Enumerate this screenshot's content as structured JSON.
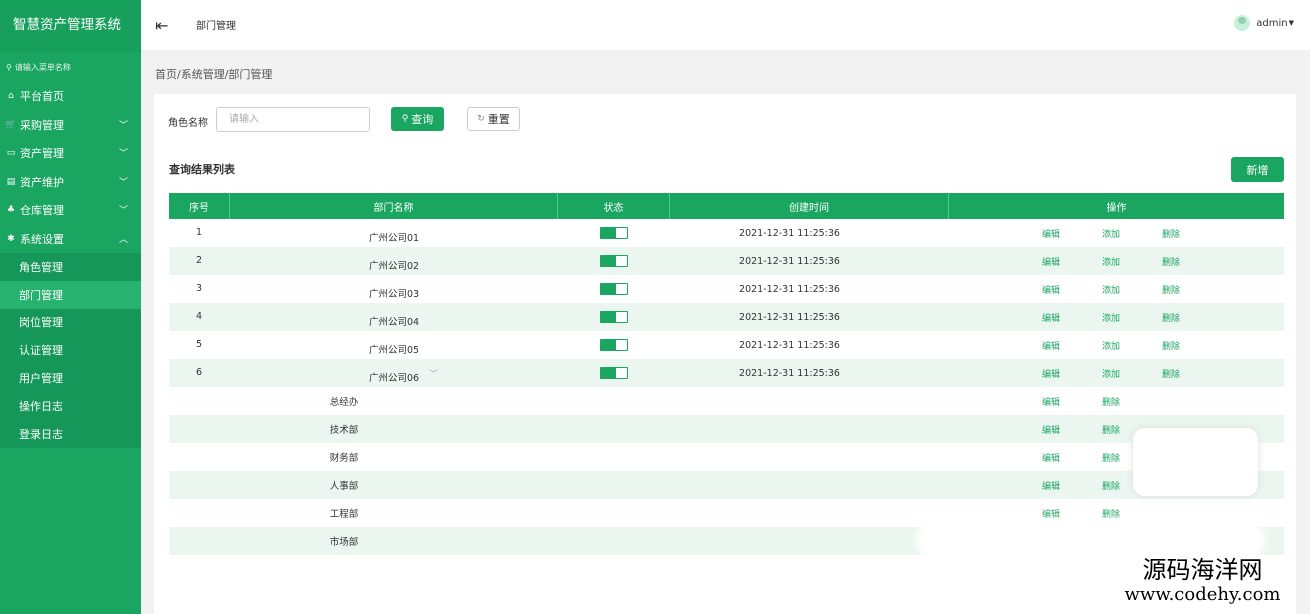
{
  "app": {
    "title": "智慧资产管理系统"
  },
  "sidebar": {
    "search_placeholder": "请输入菜单名称",
    "items": [
      {
        "label": "平台首页",
        "icon": "home-icon",
        "has_chevron": false
      },
      {
        "label": "采购管理",
        "icon": "cart-icon",
        "has_chevron": true
      },
      {
        "label": "资产管理",
        "icon": "monitor-icon",
        "has_chevron": true
      },
      {
        "label": "资产维护",
        "icon": "wrench-icon",
        "has_chevron": true
      },
      {
        "label": "仓库管理",
        "icon": "warehouse-icon",
        "has_chevron": true
      },
      {
        "label": "系统设置",
        "icon": "gear-icon",
        "has_chevron": true,
        "expanded": true
      }
    ],
    "sub_items": [
      "角色管理",
      "部门管理",
      "岗位管理",
      "认证管理",
      "用户管理",
      "操作日志",
      "登录日志"
    ],
    "active_sub": "部门管理"
  },
  "header": {
    "title": "部门管理",
    "user": "admin"
  },
  "breadcrumb": "首页/系统管理/部门管理",
  "search": {
    "label": "角色名称",
    "placeholder": "请输入",
    "query_label": "查询",
    "reset_label": "重置"
  },
  "result": {
    "title": "查询结果列表",
    "add_label": "新增"
  },
  "table": {
    "headers": [
      "序号",
      "部门名称",
      "状态",
      "创建时间",
      "操作"
    ],
    "rows": [
      {
        "no": "1",
        "name": "广州公司01",
        "status": "on",
        "created": "2021-12-31 11:25:36",
        "ops": [
          "编辑",
          "添加",
          "删除"
        ]
      },
      {
        "no": "2",
        "name": "广州公司02",
        "status": "on",
        "created": "2021-12-31 11:25:36",
        "ops": [
          "编辑",
          "添加",
          "删除"
        ]
      },
      {
        "no": "3",
        "name": "广州公司03",
        "status": "on",
        "created": "2021-12-31 11:25:36",
        "ops": [
          "编辑",
          "添加",
          "删除"
        ]
      },
      {
        "no": "4",
        "name": "广州公司04",
        "status": "on",
        "created": "2021-12-31 11:25:36",
        "ops": [
          "编辑",
          "添加",
          "删除"
        ]
      },
      {
        "no": "5",
        "name": "广州公司05",
        "status": "on",
        "created": "2021-12-31 11:25:36",
        "ops": [
          "编辑",
          "添加",
          "删除"
        ]
      },
      {
        "no": "6",
        "name": "广州公司06",
        "status": "on",
        "created": "2021-12-31 11:25:36",
        "ops": [
          "编辑",
          "添加",
          "删除"
        ],
        "expanded": true
      }
    ],
    "child_rows": [
      {
        "name": "总经办",
        "ops": [
          "编辑",
          "删除"
        ]
      },
      {
        "name": "技术部",
        "ops": [
          "编辑",
          "删除"
        ]
      },
      {
        "name": "财务部",
        "ops": [
          "编辑",
          "删除"
        ]
      },
      {
        "name": "人事部",
        "ops": [
          "编辑",
          "删除"
        ]
      },
      {
        "name": "工程部",
        "ops": [
          "编辑",
          "删除"
        ]
      },
      {
        "name": "市场部",
        "ops": []
      }
    ]
  },
  "watermark": {
    "cn": "源码海洋网",
    "url": "www.codehy.com"
  },
  "colors": {
    "primary": "#1aa561",
    "row_stripe": "#eaf6ef"
  }
}
